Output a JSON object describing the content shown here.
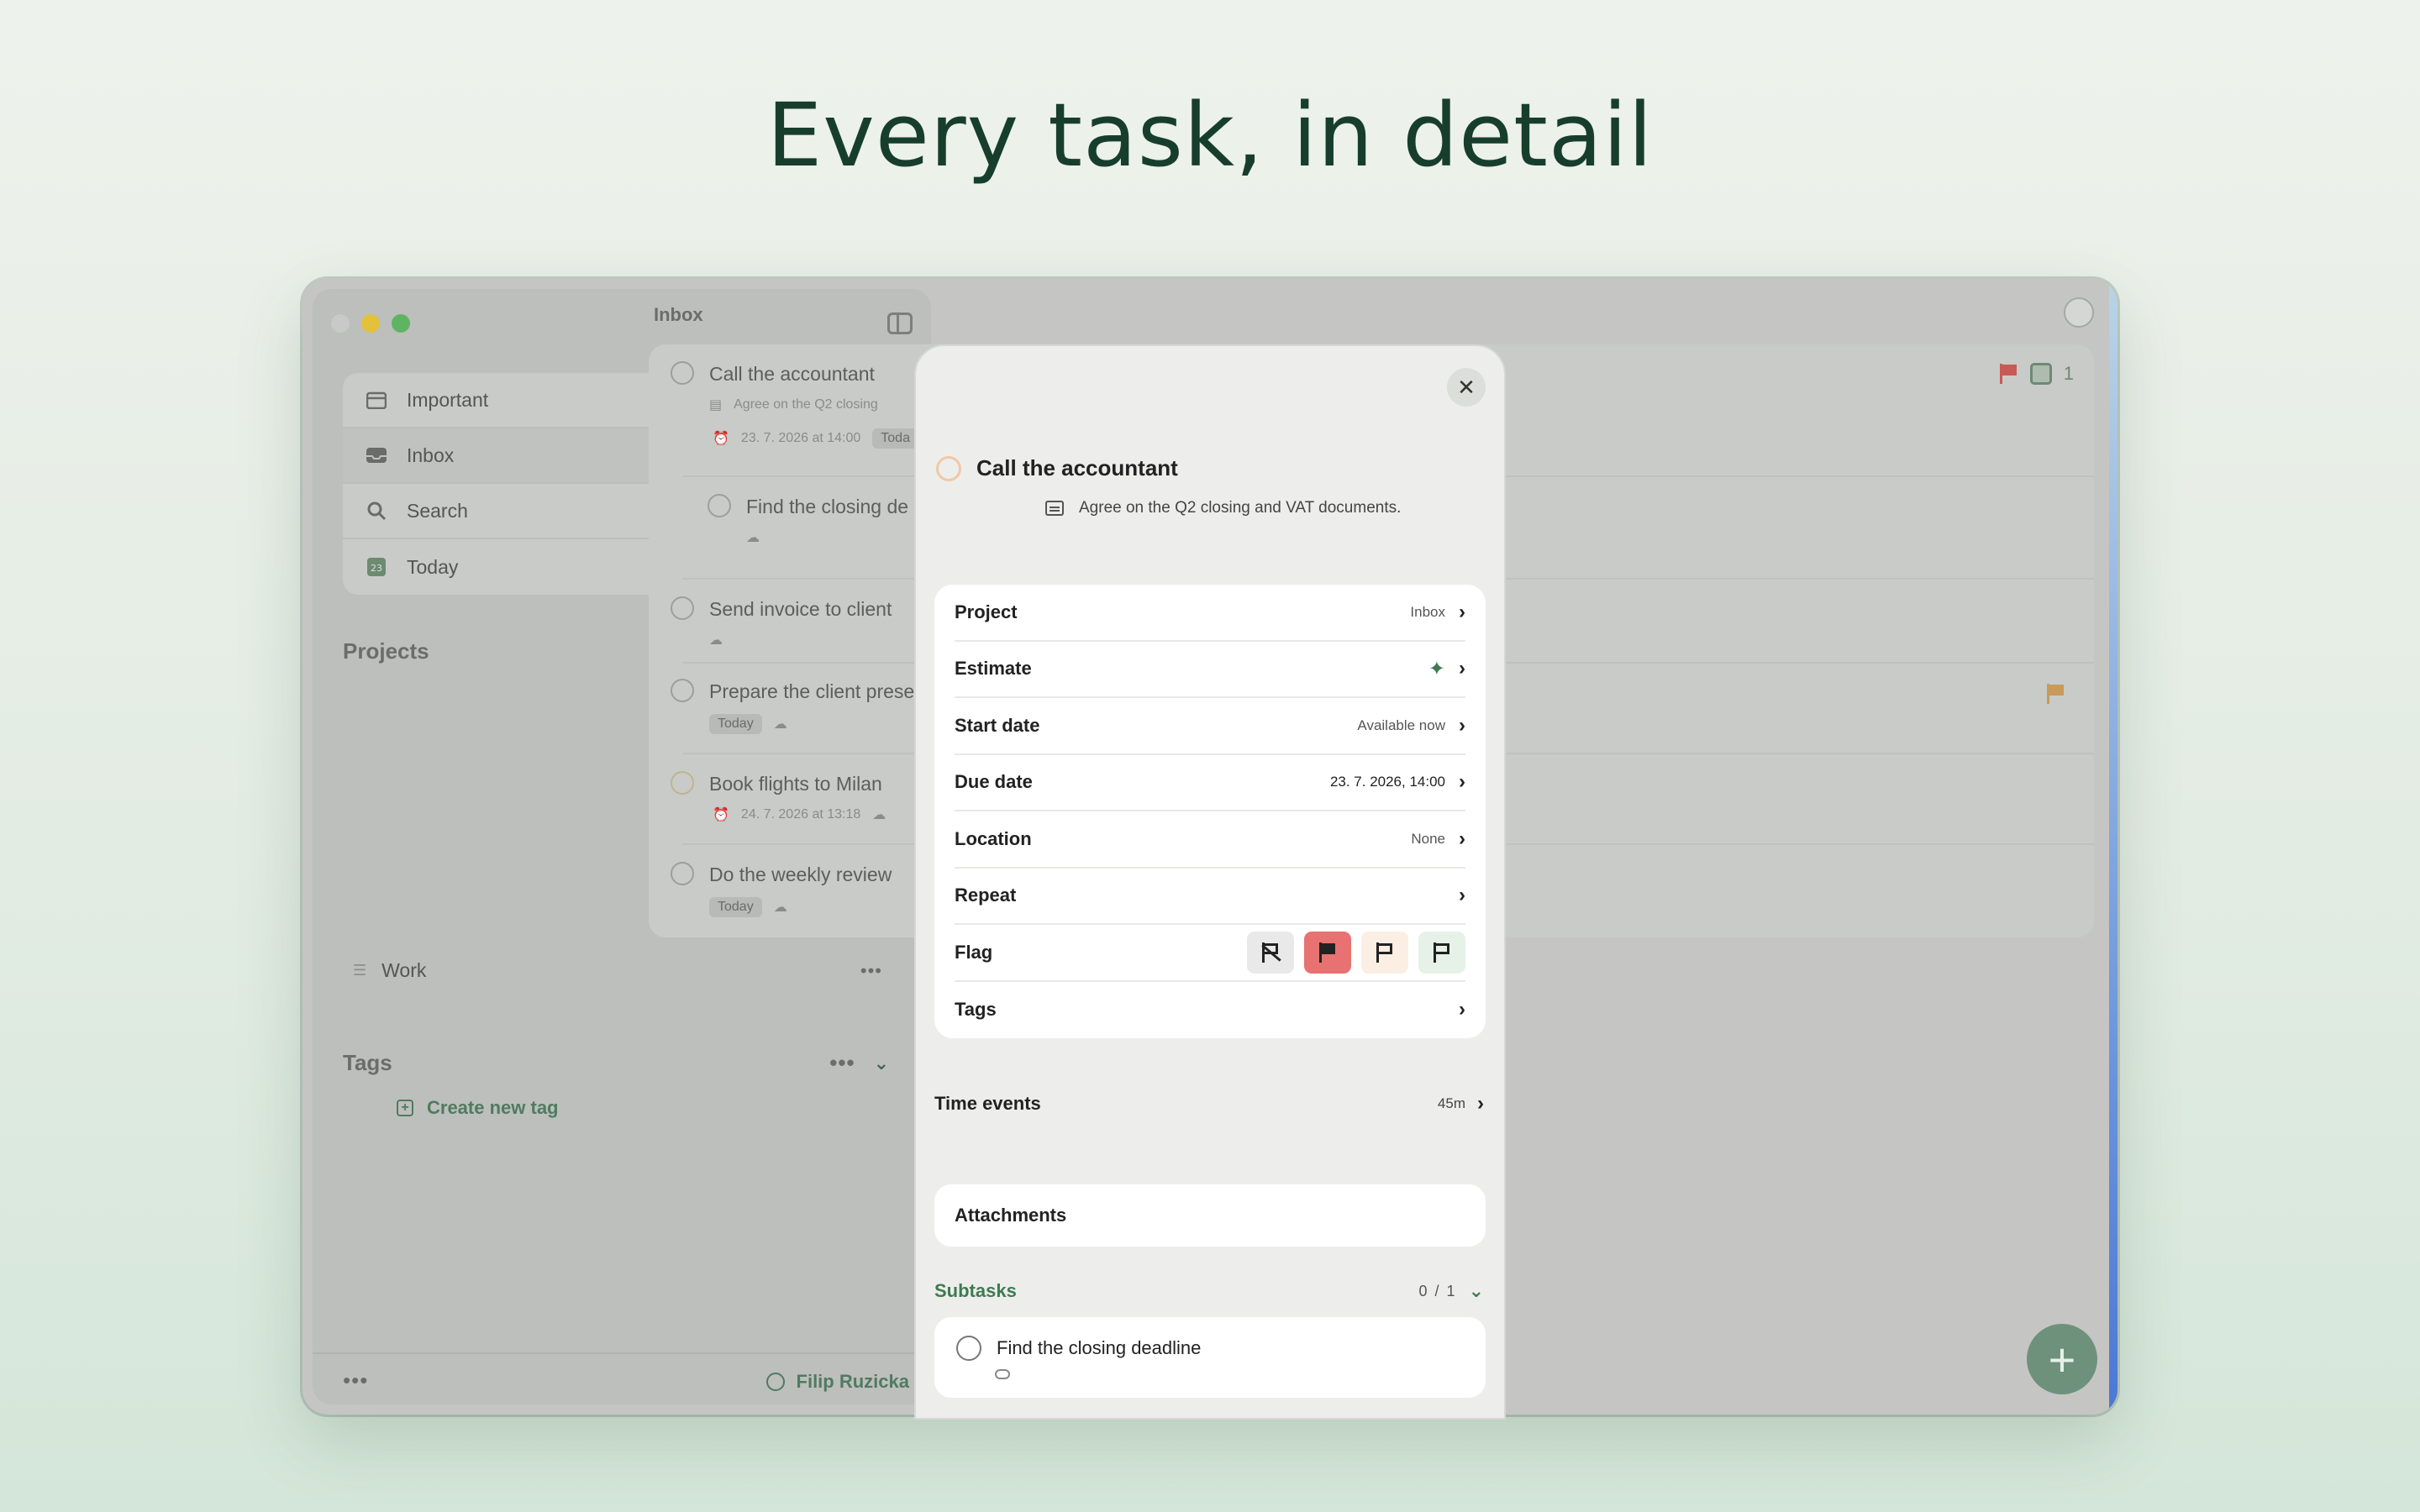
{
  "headline": "Every task, in detail",
  "sidebar": {
    "nav": [
      {
        "label": "Important",
        "icon": "calendar-icon"
      },
      {
        "label": "Inbox",
        "icon": "inbox-icon"
      },
      {
        "label": "Search",
        "icon": "search-icon"
      },
      {
        "label": "Today",
        "icon": "today-icon",
        "badge": "23"
      }
    ],
    "projects_header": "Projects",
    "projects": [
      {
        "label": "Work"
      }
    ],
    "tags_header": "Tags",
    "create_tag": "Create new tag",
    "user": "Filip Ruzicka",
    "more": "•••"
  },
  "main": {
    "title": "Inbox",
    "badge_count": "1",
    "tasks": [
      {
        "title": "Call the accountant",
        "note": "Agree on the Q2 closing",
        "due": "23. 7. 2026 at 14:00",
        "pill": "Toda"
      },
      {
        "title": "Find the closing de"
      },
      {
        "title": "Send invoice to client"
      },
      {
        "title": "Prepare the client prese",
        "pill": "Today"
      },
      {
        "title": "Book flights to Milan",
        "due": "24. 7. 2026 at 13:18"
      },
      {
        "title": "Do the weekly review",
        "pill": "Today"
      }
    ],
    "fab": "+"
  },
  "modal": {
    "close": "✕",
    "title": "Call the accountant",
    "note": "Agree on the Q2 closing and VAT documents.",
    "properties": {
      "project": {
        "label": "Project",
        "value": "Inbox"
      },
      "estimate": {
        "label": "Estimate",
        "value": ""
      },
      "start": {
        "label": "Start date",
        "value": "Available now"
      },
      "due": {
        "label": "Due date",
        "value": "23. 7. 2026, 14:00"
      },
      "location": {
        "label": "Location",
        "value": "None"
      },
      "repeat": {
        "label": "Repeat",
        "value": ""
      },
      "flag": {
        "label": "Flag",
        "selected": "red"
      },
      "tags": {
        "label": "Tags",
        "value": ""
      }
    },
    "time_events": {
      "label": "Time events",
      "value": "45m"
    },
    "attachments": "Attachments",
    "subtasks": {
      "label": "Subtasks",
      "done": "0",
      "total": "1",
      "sep": "/",
      "items": [
        {
          "title": "Find the closing deadline"
        }
      ]
    }
  },
  "colors": {
    "accent": "#3f7a52",
    "flag_red": "#e87272",
    "flag_orange": "#fbeee2",
    "flag_green": "#e6f2e8"
  }
}
